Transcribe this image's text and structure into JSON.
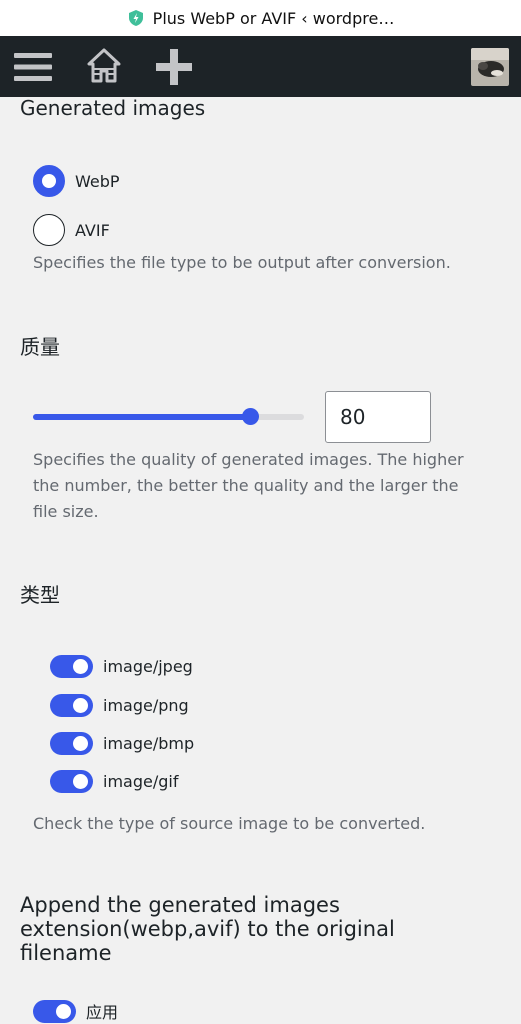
{
  "browser": {
    "url_text": "Plus WebP or AVIF ‹ wordpre…"
  },
  "admin_bar": {
    "menu_icon": "hamburger-icon",
    "home_icon": "home-icon",
    "add_icon": "plus-icon",
    "avatar_icon": "user-avatar"
  },
  "generated_images": {
    "title": "Generated images",
    "options": [
      {
        "label": "WebP",
        "checked": true
      },
      {
        "label": "AVIF",
        "checked": false
      }
    ],
    "description": "Specifies the file type to be output after conversion."
  },
  "quality": {
    "title": "质量",
    "value": "80",
    "level_percent": 80,
    "description": "Specifies the quality of generated images. The higher the number, the better the quality and the larger the file size."
  },
  "types": {
    "title": "类型",
    "items": [
      {
        "label": "image/jpeg",
        "on": true
      },
      {
        "label": "image/png",
        "on": true
      },
      {
        "label": "image/bmp",
        "on": true
      },
      {
        "label": "image/gif",
        "on": true
      }
    ],
    "description": "Check the type of source image to be converted."
  },
  "append_ext": {
    "title": "Append the generated images extension(webp,avif) to the original filename",
    "toggle_label": "应用",
    "on": true
  },
  "colors": {
    "accent": "#3858e9",
    "admin_bar": "#1d2327",
    "background": "#f1f1f1"
  }
}
